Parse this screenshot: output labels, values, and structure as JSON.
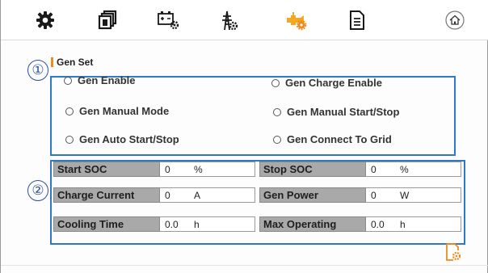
{
  "toolbar": {
    "icons": [
      {
        "name": "gear-icon"
      },
      {
        "name": "battery-stack-icon"
      },
      {
        "name": "battery-settings-icon"
      },
      {
        "name": "grid-tower-settings-icon"
      },
      {
        "name": "generator-settings-icon"
      },
      {
        "name": "document-icon"
      },
      {
        "name": "home-icon"
      }
    ],
    "active_color": "#f08a1c"
  },
  "annotations": {
    "marker_1": "①",
    "marker_2": "②"
  },
  "gen_set": {
    "title": "Gen Set",
    "options": {
      "gen_enable": "Gen Enable",
      "gen_charge_enable": "Gen Charge Enable",
      "gen_manual_mode": "Gen Manual Mode",
      "gen_manual_start_stop": "Gen Manual Start/Stop",
      "gen_auto_start_stop": "Gen Auto Start/Stop",
      "gen_connect_to_grid": "Gen Connect To Grid"
    }
  },
  "fields": {
    "start_soc": {
      "label": "Start SOC",
      "value": "0",
      "unit": "%"
    },
    "stop_soc": {
      "label": "Stop SOC",
      "value": "0",
      "unit": "%"
    },
    "charge_current": {
      "label": "Charge Current",
      "value": "0",
      "unit": "A"
    },
    "gen_power": {
      "label": "Gen Power",
      "value": "0",
      "unit": "W"
    },
    "cooling_time": {
      "label": "Cooling Time",
      "value": "0.0",
      "unit": "h"
    },
    "max_operating": {
      "label": "Max Operating",
      "value": "0.0",
      "unit": "h"
    }
  },
  "colors": {
    "highlight_box": "#2e79c6",
    "label_bg": "#a9a9a9",
    "accent": "#f08a1c"
  }
}
